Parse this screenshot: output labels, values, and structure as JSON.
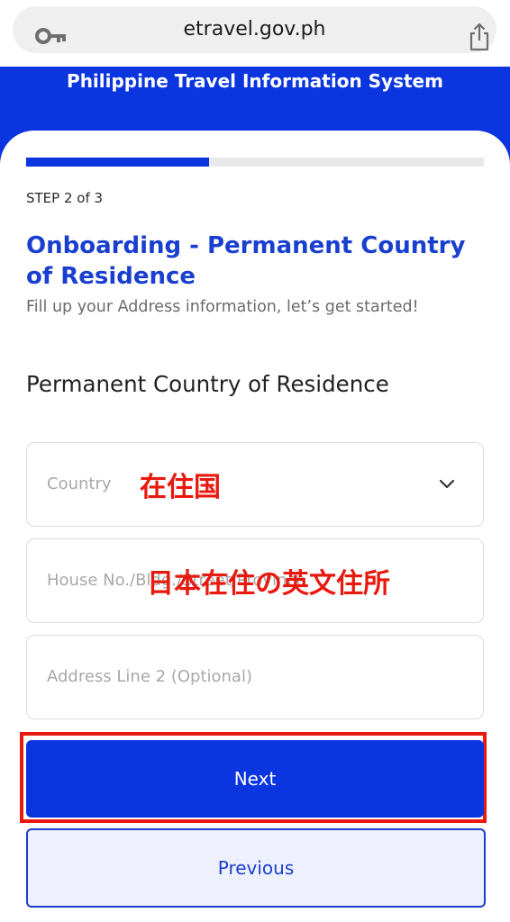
{
  "browser": {
    "url": "etravel.gov.ph",
    "left_icon": "key-icon",
    "right_icon": "share-icon"
  },
  "header": {
    "title": "Philippine Travel Information System",
    "background_color": "#0a35df"
  },
  "progress": {
    "current_step": 2,
    "total_steps": 3,
    "fill_fraction": 0.4,
    "step_label": "STEP 2 of 3"
  },
  "page": {
    "title": "Onboarding - Permanent Country of Residence",
    "subtitle": "Fill up your Address information, let’s get started!",
    "section_heading": "Permanent Country of Residence"
  },
  "form": {
    "country_placeholder": "Country",
    "country_icon": "chevron-down-icon",
    "house_placeholder": "House No./Bldg./Street/Province",
    "address2_placeholder": "Address Line 2 (Optional)"
  },
  "annotations": {
    "country_note": "在住国",
    "address_note": "日本在住の英文住所",
    "color": "#e8190e"
  },
  "buttons": {
    "next_label": "Next",
    "previous_label": "Previous"
  },
  "colors": {
    "primary": "#0a35df",
    "title_blue": "#1a3fd0"
  }
}
